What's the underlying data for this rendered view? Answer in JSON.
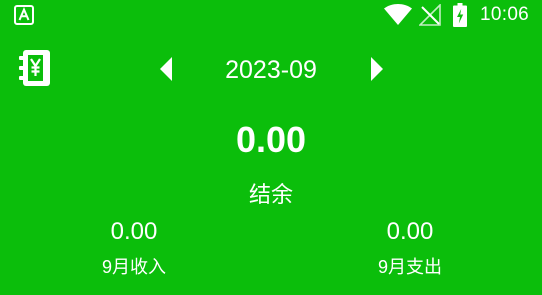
{
  "status_bar": {
    "time": "10:06",
    "app_indicator_icon": "android-a-icon",
    "wifi_icon": "wifi-icon",
    "signal_icon": "no-signal-icon",
    "battery_icon": "battery-charging-icon"
  },
  "header": {
    "ledger_icon": "ledger-book-icon",
    "prev_icon": "caret-left-icon",
    "next_icon": "caret-right-icon",
    "month": "2023-09"
  },
  "balance": {
    "amount": "0.00",
    "label": "结余"
  },
  "income": {
    "amount": "0.00",
    "label": "9月收入"
  },
  "expense": {
    "amount": "0.00",
    "label": "9月支出"
  },
  "colors": {
    "background": "#0bbe0b",
    "foreground": "#ffffff"
  }
}
